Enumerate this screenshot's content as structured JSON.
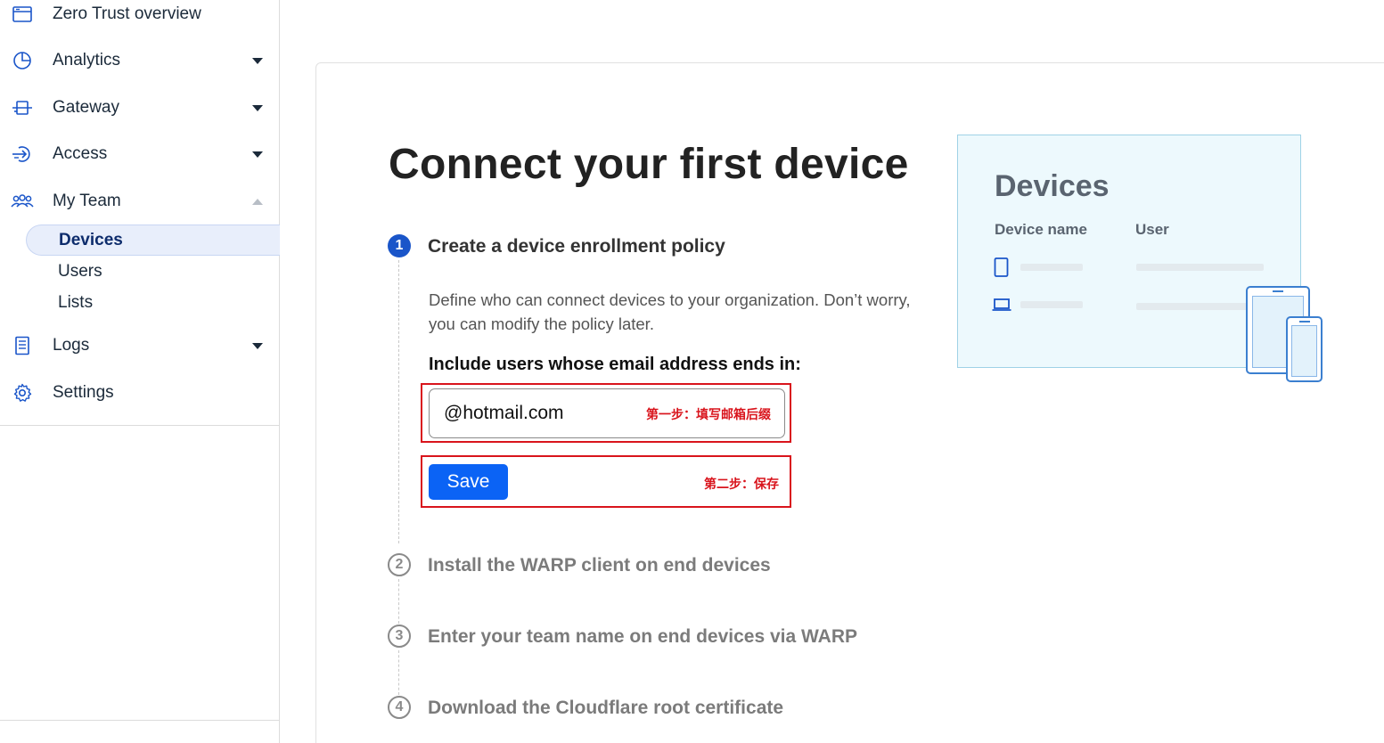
{
  "sidebar": {
    "items": [
      {
        "label": "Zero Trust overview",
        "icon": "window-icon"
      },
      {
        "label": "Analytics",
        "icon": "pie-chart-icon"
      },
      {
        "label": "Gateway",
        "icon": "gateway-icon"
      },
      {
        "label": "Access",
        "icon": "access-icon"
      },
      {
        "label": "My Team",
        "icon": "team-icon"
      },
      {
        "label": "Logs",
        "icon": "logs-icon"
      },
      {
        "label": "Settings",
        "icon": "gear-icon"
      }
    ],
    "sub_items": [
      {
        "label": "Devices",
        "active": true
      },
      {
        "label": "Users"
      },
      {
        "label": "Lists"
      }
    ]
  },
  "main": {
    "title": "Connect your first device",
    "steps": [
      {
        "number": "1",
        "title": "Create a device enrollment policy",
        "active": true
      },
      {
        "number": "2",
        "title": "Install the WARP client on end devices"
      },
      {
        "number": "3",
        "title": "Enter your team name on end devices via WARP"
      },
      {
        "number": "4",
        "title": "Download the Cloudflare root certificate"
      }
    ],
    "description": "Define who can connect devices to your organization. Don’t worry, you can modify the policy later.",
    "include_label": "Include users whose email address ends in:",
    "email_value": "@hotmail.com",
    "save_label": "Save",
    "annotation_step1": "第一步：填写邮箱后缀",
    "annotation_step2": "第二步：保存"
  },
  "illustration": {
    "title": "Devices",
    "col_device": "Device name",
    "col_user": "User"
  },
  "colors": {
    "accent": "#0b63f5",
    "step_active": "#1a55c9",
    "annotation_red": "#d9141c"
  }
}
